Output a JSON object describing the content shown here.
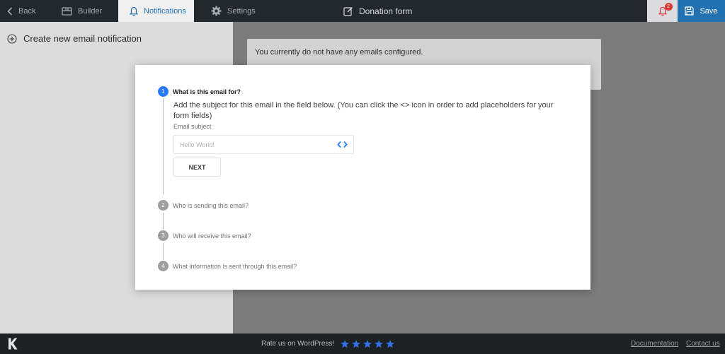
{
  "topbar": {
    "back_label": "Back",
    "builder_label": "Builder",
    "notifications_label": "Notifications",
    "settings_label": "Settings",
    "form_title": "Donation form",
    "notification_count": "2",
    "save_label": "Save"
  },
  "sidebar": {
    "create_label": "Create new email notification"
  },
  "main": {
    "empty_message": "You currently do not have any emails configured."
  },
  "modal": {
    "steps": [
      {
        "number": "1",
        "title": "What is this email for?"
      },
      {
        "number": "2",
        "title": "Who is sending this email?"
      },
      {
        "number": "3",
        "title": "Who will receive this email?"
      },
      {
        "number": "4",
        "title": "What information is sent through this email?"
      }
    ],
    "description": "Add the subject for this email in the field below. (You can click the <> icon in order to add placeholders for your form fields)",
    "field_label": "Email subject",
    "subject_placeholder": "Hello World!",
    "subject_value": "",
    "next_label": "NEXT"
  },
  "footer": {
    "rate_text": "Rate us on WordPress!",
    "star_count": 5,
    "doc_link": "Documentation",
    "contact_link": "Contact us"
  },
  "colors": {
    "accent": "#2271b1",
    "step_active": "#2979ff",
    "star": "#2f6fe0",
    "badge": "#d63638"
  },
  "icons": {
    "back": "chevron-left-icon",
    "builder": "builder-icon",
    "notifications": "bell-icon",
    "settings": "gear-icon",
    "form": "edit-icon",
    "save": "save-icon",
    "create": "plus-circle-icon",
    "placeholder": "code-icon",
    "star": "star-icon"
  }
}
